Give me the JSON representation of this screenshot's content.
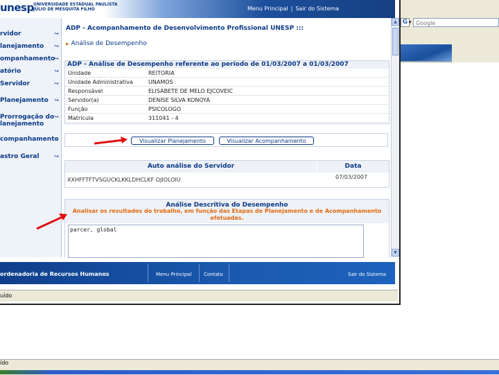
{
  "browser": {
    "search_placeholder": "Google",
    "status_text": "uído",
    "taskbar_text": "ído"
  },
  "header": {
    "logo": "unesp",
    "university_line1": "UNIVERSIDADE ESTADUAL PAULISTA",
    "university_line2": "JÚLIO DE MESQUITA FILHO",
    "menu_principal": "Menu Principal",
    "separator": "|",
    "sair": "Sair do Sistema"
  },
  "sidebar": {
    "items": [
      {
        "label": "rvidor"
      },
      {
        "label": "lanejamento"
      },
      {
        "label": "ompanhamento"
      },
      {
        "label": "atório"
      },
      {
        "label": "Servidor"
      },
      {
        "label": "Planejamento"
      },
      {
        "label": "Prorrogação do"
      },
      {
        "label": "lanejamento"
      },
      {
        "label": "companhamento"
      },
      {
        "label": "astro Geral"
      }
    ]
  },
  "main": {
    "page_title": "ADP - Acompanhamento de Desenvolvimento Profissional UNESP :::",
    "section_title": "Análise de Desempenho",
    "info_header": "ADP - Análise de Desempenho referente ao período de 01/03/2007 a 01/03/2007",
    "info_rows": [
      {
        "label": "Unidade",
        "value": "REITORIA"
      },
      {
        "label": "Unidade Administrativa",
        "value": "UNAMOS"
      },
      {
        "label": "Responsável",
        "value": "ELISABETE DE MELO EJCOVEIC"
      },
      {
        "label": "Servidor(a)",
        "value": "DENISE SILVA KONOYA"
      },
      {
        "label": "Função",
        "value": "PSICOLOGO"
      },
      {
        "label": "Matrícula",
        "value": "311041 - 4"
      }
    ],
    "btn_planejamento": "Visualizar Planejamento",
    "btn_acompanhamento": "Visualizar Acompanhamento",
    "auto_header": "Auto análise do Servidor",
    "date_header": "Data",
    "auto_value": "XXHFFTFTVSGUCKLKKLDHCLKF OJIOLOIU",
    "date_value": "07/03/2007",
    "desc_title": "Análise Descritiva do Desempenho",
    "desc_subtitle": "Analisar os resultados do trabalho, em função das Etapas de Planejamento e de Acompanhamento efetuadas.",
    "desc_text": "parcer, global"
  },
  "footer": {
    "title": "ordenadoria de Recursos Humanos",
    "menu_principal": "Menu Principal",
    "contato": "Contato",
    "sair": "Sair do Sistema"
  },
  "colors": {
    "brand_blue": "#0b3a86",
    "accent_orange": "#e06a10",
    "arrow_red": "#e01010"
  }
}
